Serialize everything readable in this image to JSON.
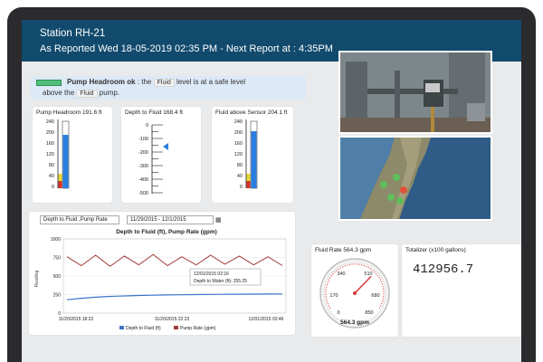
{
  "header": {
    "station": "Station RH-21",
    "reported": "As Reported Wed 18-05-2019 02:35 PM - Next Report at : 4:35PM"
  },
  "status": {
    "bold": "Pump Headroom ok",
    "text1": ": the",
    "pill1": "Fluid",
    "text2": "level is at a safe level",
    "text3": "above the",
    "pill2": "Fluid",
    "text4": "pump."
  },
  "gauges": {
    "pump_headroom": {
      "title": "Pump Headroom 191.6 ft",
      "ticks": [
        "240",
        "200",
        "160",
        "120",
        "80",
        "40",
        "0"
      ],
      "value": 191.6,
      "min": 0,
      "max": 240
    },
    "depth_to_fluid": {
      "title": "Depth to Fluid 168.4 ft",
      "ticks": [
        "0",
        "-100",
        "-200",
        "-300",
        "-400",
        "-500"
      ],
      "value": -168.4,
      "min": -500,
      "max": 0
    },
    "fluid_above_sensor": {
      "title": "Fluid above Sensor 204.1 ft",
      "ticks": [
        "240",
        "200",
        "160",
        "120",
        "80",
        "40",
        "0"
      ],
      "value": 204.1,
      "min": 0,
      "max": 240
    }
  },
  "chart_controls": {
    "metric": "Depth to Fluid ,Pump Rate",
    "dates": "11/29/2015 - 12/1/2015"
  },
  "chart": {
    "title": "Depth to Fluid (ft), Pump Rate (gpm)",
    "y_label": "Reading",
    "tooltip_line1": "12/01/2015 02:16",
    "tooltip_line2": "Depth to Water (ft): 255.25",
    "legend": [
      "Depth to Fluid (ft)",
      "Pump Rate (gpm)"
    ]
  },
  "chart_data": {
    "type": "line",
    "x": [
      "11/20/2015 18:22",
      "11/20/2015 22:23",
      "12/01/2015 02:46"
    ],
    "y_ticks": [
      0,
      250,
      500,
      750,
      1000
    ],
    "ylim": [
      0,
      1000
    ],
    "series": [
      {
        "name": "Depth to Fluid (ft)",
        "color": "#3a74c8",
        "values": [
          180,
          200,
          215,
          225,
          232,
          238,
          242,
          245,
          248,
          250,
          252,
          254,
          255,
          256,
          257,
          258
        ]
      },
      {
        "name": "Pump Rate (gpm)",
        "color": "#a13a3a",
        "values": [
          760,
          640,
          780,
          630,
          770,
          650,
          790,
          640,
          760,
          650,
          780,
          660,
          770,
          650,
          760,
          640
        ]
      }
    ]
  },
  "pump_rate": {
    "title": "Fluid Rate 564.3 gpm",
    "value_label": "564.3 gpm",
    "dial_ticks": [
      "170",
      "340",
      "510",
      "680",
      "850",
      "0"
    ],
    "value": 564.3,
    "max": 850
  },
  "totalizer": {
    "title": "Totalizer (x100 gallons)",
    "value": "412956.7"
  },
  "colors": {
    "header": "#114a6d",
    "bar": "#2a7ee0",
    "warn": "#e8d833",
    "alarm": "#d8322a"
  }
}
